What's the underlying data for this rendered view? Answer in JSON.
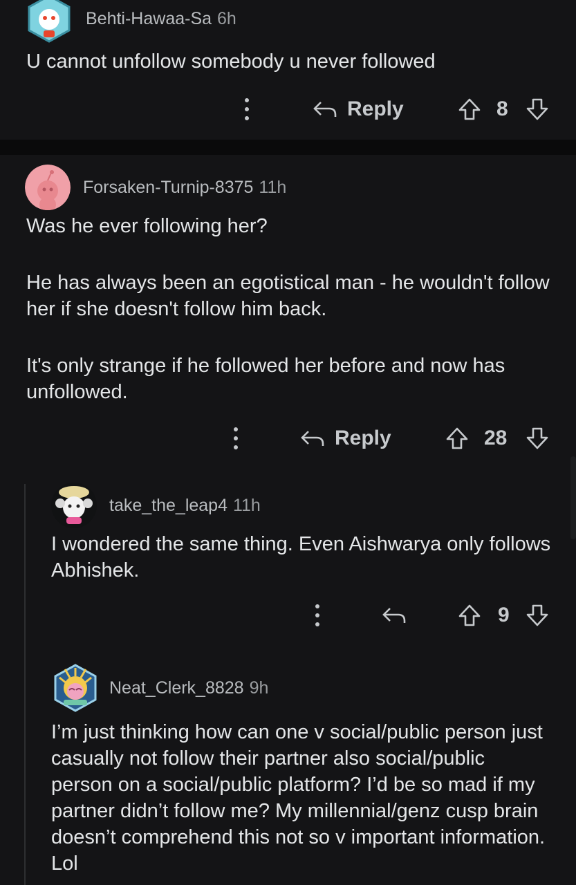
{
  "comments": [
    {
      "username": "Behti-Hawaa-Sa",
      "time": "6h",
      "text": [
        "U cannot unfollow somebody u never followed"
      ],
      "reply_label": "Reply",
      "votes": "8"
    },
    {
      "username": "Forsaken-Turnip-8375",
      "time": "11h",
      "text": [
        "Was he ever following her?",
        "He has always been an egotistical man - he wouldn't follow her if she doesn't follow him back.",
        "It's only strange if he followed her before and now has unfollowed."
      ],
      "reply_label": "Reply",
      "votes": "28"
    },
    {
      "username": "take_the_leap4",
      "time": "11h",
      "text": [
        "I wondered the same thing. Even Aishwarya only follows Abhishek."
      ],
      "votes": "9"
    },
    {
      "username": "Neat_Clerk_8828",
      "time": "9h",
      "text": [
        "I’m just thinking how can one v social/public person just casually not follow their partner also social/public person on a social/public platform? I’d be so mad if my partner didn’t follow me? My millennial/genz cusp brain doesn’t comprehend this not so v important information. Lol"
      ]
    }
  ]
}
